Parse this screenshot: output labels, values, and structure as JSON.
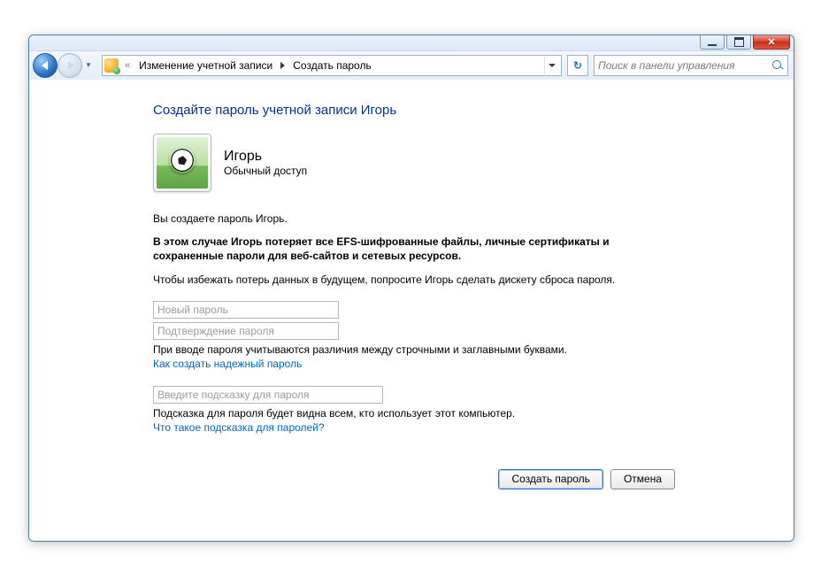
{
  "breadcrumb": {
    "prefix": "«",
    "seg1": "Изменение учетной записи",
    "seg2": "Создать пароль"
  },
  "search": {
    "placeholder": "Поиск в панели управления"
  },
  "page": {
    "title": "Создайте пароль учетной записи Игорь",
    "user_name": "Игорь",
    "user_role": "Обычный доступ",
    "line1": "Вы создаете пароль Игорь.",
    "warning": "В этом случае Игорь потеряет все EFS-шифрованные файлы, личные сертификаты и сохраненные пароли для веб-сайтов и сетевых ресурсов.",
    "line3": "Чтобы избежать потерь данных в будущем, попросите Игорь сделать дискету сброса пароля.",
    "pw_placeholder": "Новый пароль",
    "pw_confirm_placeholder": "Подтверждение пароля",
    "case_note": "При вводе пароля учитываются различия между строчными и заглавными буквами.",
    "strong_link": "Как создать надежный пароль",
    "hint_placeholder": "Введите подсказку для пароля",
    "hint_note": "Подсказка для пароля будет видна всем, кто использует этот компьютер.",
    "hint_link": "Что такое подсказка для паролей?",
    "btn_create": "Создать пароль",
    "btn_cancel": "Отмена"
  }
}
